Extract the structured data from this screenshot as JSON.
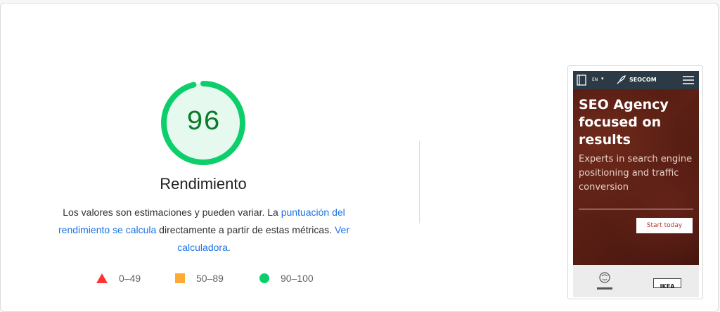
{
  "performance": {
    "score": "96",
    "score_fraction": 0.96,
    "title": "Rendimiento",
    "description_before": "Los valores son estimaciones y pueden variar. La ",
    "link_1": "puntuación del rendimiento se calcula",
    "description_middle": " directamente a partir de estas métricas. ",
    "link_2": "Ver calculadora",
    "description_after": ".",
    "colors": {
      "pass": "#0cce6b",
      "pass_text": "#0c7a2c",
      "pass_bg": "#e6f9ef"
    }
  },
  "legend": [
    {
      "icon": "red-triangle-icon",
      "range": "0–49",
      "color": "#ff3333"
    },
    {
      "icon": "orange-square-icon",
      "range": "50–89",
      "color": "#ffaa33"
    },
    {
      "icon": "green-circle-icon",
      "range": "90–100",
      "color": "#0cce6b"
    }
  ],
  "screenshot": {
    "lang": "EN",
    "brand": "SEOCOM",
    "hero_title": "SEO Agency focused on results",
    "hero_subtitle": "Experts in search engine positioning and traffic conversion",
    "cta": "Start today",
    "client_logo": "IKEA"
  }
}
